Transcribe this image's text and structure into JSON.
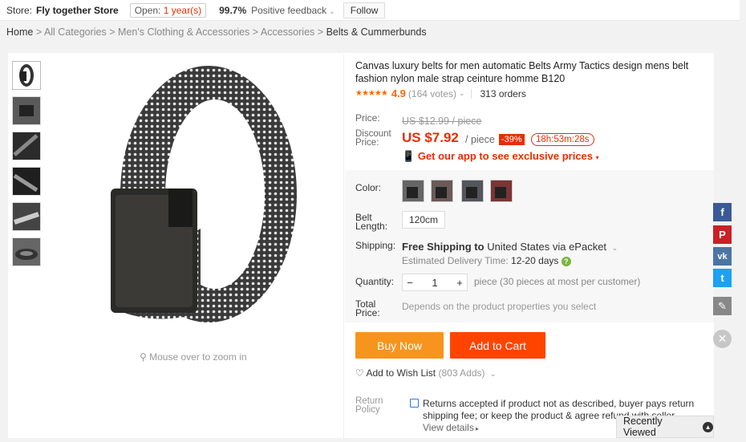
{
  "store": {
    "label": "Store:",
    "name": "Fly together Store",
    "open_prefix": "Open:",
    "open_years": "1 year(s)",
    "feedback_pct": "99.7%",
    "feedback_text": "Positive feedback",
    "follow": "Follow"
  },
  "breadcrumb": {
    "home": "Home",
    "items": [
      "All Categories",
      "Men's Clothing & Accessories",
      "Accessories"
    ],
    "current": "Belts & Cummerbunds",
    "sep": ">"
  },
  "gallery": {
    "zoom_hint": "Mouse over to zoom in",
    "thumb_count": 6
  },
  "product": {
    "title": "Canvas luxury belts for men automatic Belts Army Tactics design mens belt fashion nylon male strap ceinture homme B120",
    "rating": "4.9",
    "votes": "(164 votes)",
    "orders": "313 orders",
    "price_label": "Price:",
    "old_price": "US $12.99 / piece",
    "discount_label_1": "Discount",
    "discount_label_2": "Price:",
    "current_price": "US $7.92",
    "per_piece": "/ piece",
    "discount_pct": "-39%",
    "timer": "18h:53m:28s",
    "app_promo": "Get our app to see exclusive prices",
    "color_label": "Color:",
    "length_label_1": "Belt",
    "length_label_2": "Length:",
    "length_value": "120cm",
    "shipping_label": "Shipping:",
    "shipping_free": "Free Shipping to",
    "shipping_dest": "United States via ePacket",
    "delivery_label": "Estimated Delivery Time:",
    "delivery_days": "12-20 days",
    "quantity_label": "Quantity:",
    "quantity_value": "1",
    "quantity_minus": "−",
    "quantity_plus": "+",
    "quantity_note": "piece (30 pieces at most per customer)",
    "total_label_1": "Total",
    "total_label_2": "Price:",
    "total_value": "Depends on the product properties you select",
    "buy_now": "Buy Now",
    "add_to_cart": "Add to Cart",
    "wish_label": "Add to Wish List",
    "wish_count": "(803 Adds)",
    "return_label_1": "Return",
    "return_label_2": "Policy",
    "return_text": "Returns accepted if product not as described, buyer pays return shipping fee; or keep the product & agree refund with seller.",
    "view_details": "View details"
  },
  "swatch_colors": [
    "#4a4a4a",
    "#5a4a48",
    "#3e3e44",
    "#6b2b2b"
  ],
  "social": [
    {
      "icon": "facebook-icon",
      "glyph": "f",
      "color": "#3b5998"
    },
    {
      "icon": "pinterest-icon",
      "glyph": "P",
      "color": "#cb2027"
    },
    {
      "icon": "vk-icon",
      "glyph": "vk",
      "color": "#4c75a3"
    },
    {
      "icon": "twitter-icon",
      "glyph": "t",
      "color": "#1da1f2"
    },
    {
      "icon": "edit-icon",
      "glyph": "✎",
      "color": "#888888"
    }
  ],
  "recently_viewed": "Recently Viewed"
}
